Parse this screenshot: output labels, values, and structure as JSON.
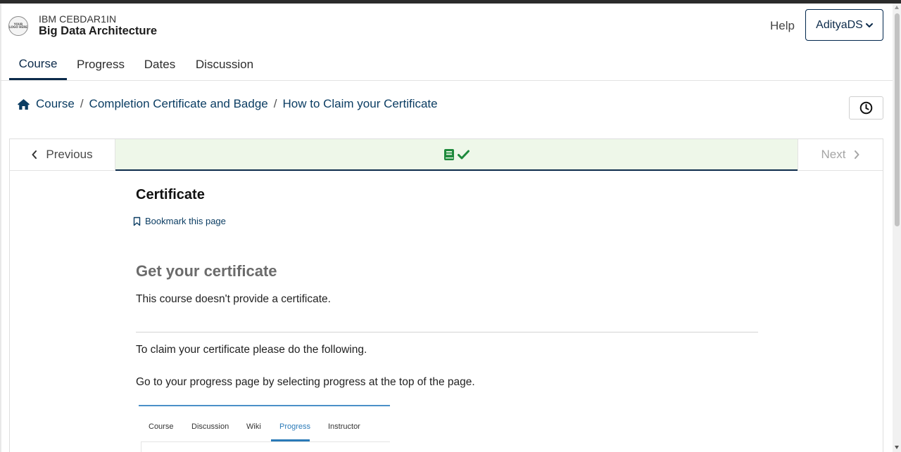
{
  "header": {
    "logo_text": "YOUR LOGO HERE",
    "org": "IBM CEBDAR1IN",
    "course_title": "Big Data Architecture",
    "help_label": "Help",
    "user_label": "AdityaDS"
  },
  "tabs": [
    {
      "label": "Course",
      "active": true
    },
    {
      "label": "Progress",
      "active": false
    },
    {
      "label": "Dates",
      "active": false
    },
    {
      "label": "Discussion",
      "active": false
    }
  ],
  "breadcrumb": {
    "items": [
      "Course",
      "Completion Certificate and Badge",
      "How to Claim your Certificate"
    ],
    "separator": "/"
  },
  "sequence": {
    "previous_label": "Previous",
    "next_label": "Next",
    "active_unit_icon": "book-check-icon",
    "active_color": "#1e8a3c"
  },
  "content": {
    "title": "Certificate",
    "bookmark_label": "Bookmark this page",
    "heading": "Get your certificate",
    "no_cert_text": "This course doesn't provide a certificate.",
    "claim_text": "To claim your certificate please do the following.",
    "instruction_text": "Go to your progress page by selecting progress at the top of the page."
  },
  "embedded_image": {
    "tabs": [
      "Course",
      "Discussion",
      "Wiki",
      "Progress",
      "Instructor"
    ],
    "active_tab": "Progress"
  },
  "colors": {
    "primary": "#0b2a4a",
    "link": "#0b3d63",
    "sequence_active_bg": "#eef7e9",
    "success": "#1e8a3c"
  }
}
